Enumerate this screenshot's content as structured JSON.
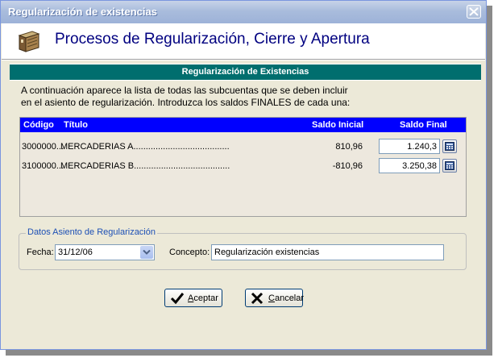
{
  "window": {
    "title": "Regularización de existencias"
  },
  "header": {
    "title": "Procesos de Regularización, Cierre y Apertura"
  },
  "section": {
    "title": "Regularización de Existencias"
  },
  "instructions": {
    "line1": "A continuación aparece la lista de todas las subcuentas que se deben incluir",
    "line2": "en el asiento de regularización. Introduzca los saldos FINALES de cada una:"
  },
  "grid": {
    "columns": {
      "codigo": "Código",
      "titulo": "Título",
      "saldo_inicial": "Saldo Inicial",
      "saldo_final": "Saldo Final"
    },
    "rows": [
      {
        "codigo": "3000000...",
        "titulo": "MERCADERIAS A.......................................",
        "saldo_inicial": "810,96",
        "saldo_final": "1.240,3"
      },
      {
        "codigo": "3100000...",
        "titulo": "MERCADERIAS B.......................................",
        "saldo_inicial": "-810,96",
        "saldo_final": "3.250,38"
      }
    ]
  },
  "asiento": {
    "legend": "Datos Asiento de Regularización",
    "fecha_label": "Fecha:",
    "fecha_value": "31/12/06",
    "concepto_label": "Concepto:",
    "concepto_value": "Regularización existencias"
  },
  "buttons": {
    "aceptar": "Aceptar",
    "cancelar": "Cancelar"
  },
  "icons": {
    "header": "ledger-book-icon",
    "close": "close-icon",
    "calculator": "calculator-icon",
    "dropdown": "chevron-down-icon",
    "ok": "checkmark-icon",
    "cancel": "x-mark-icon"
  },
  "colors": {
    "section_bar": "#006e6e",
    "grid_header": "#0000ff",
    "header_title": "#000080",
    "legend": "#1c4fb5"
  }
}
